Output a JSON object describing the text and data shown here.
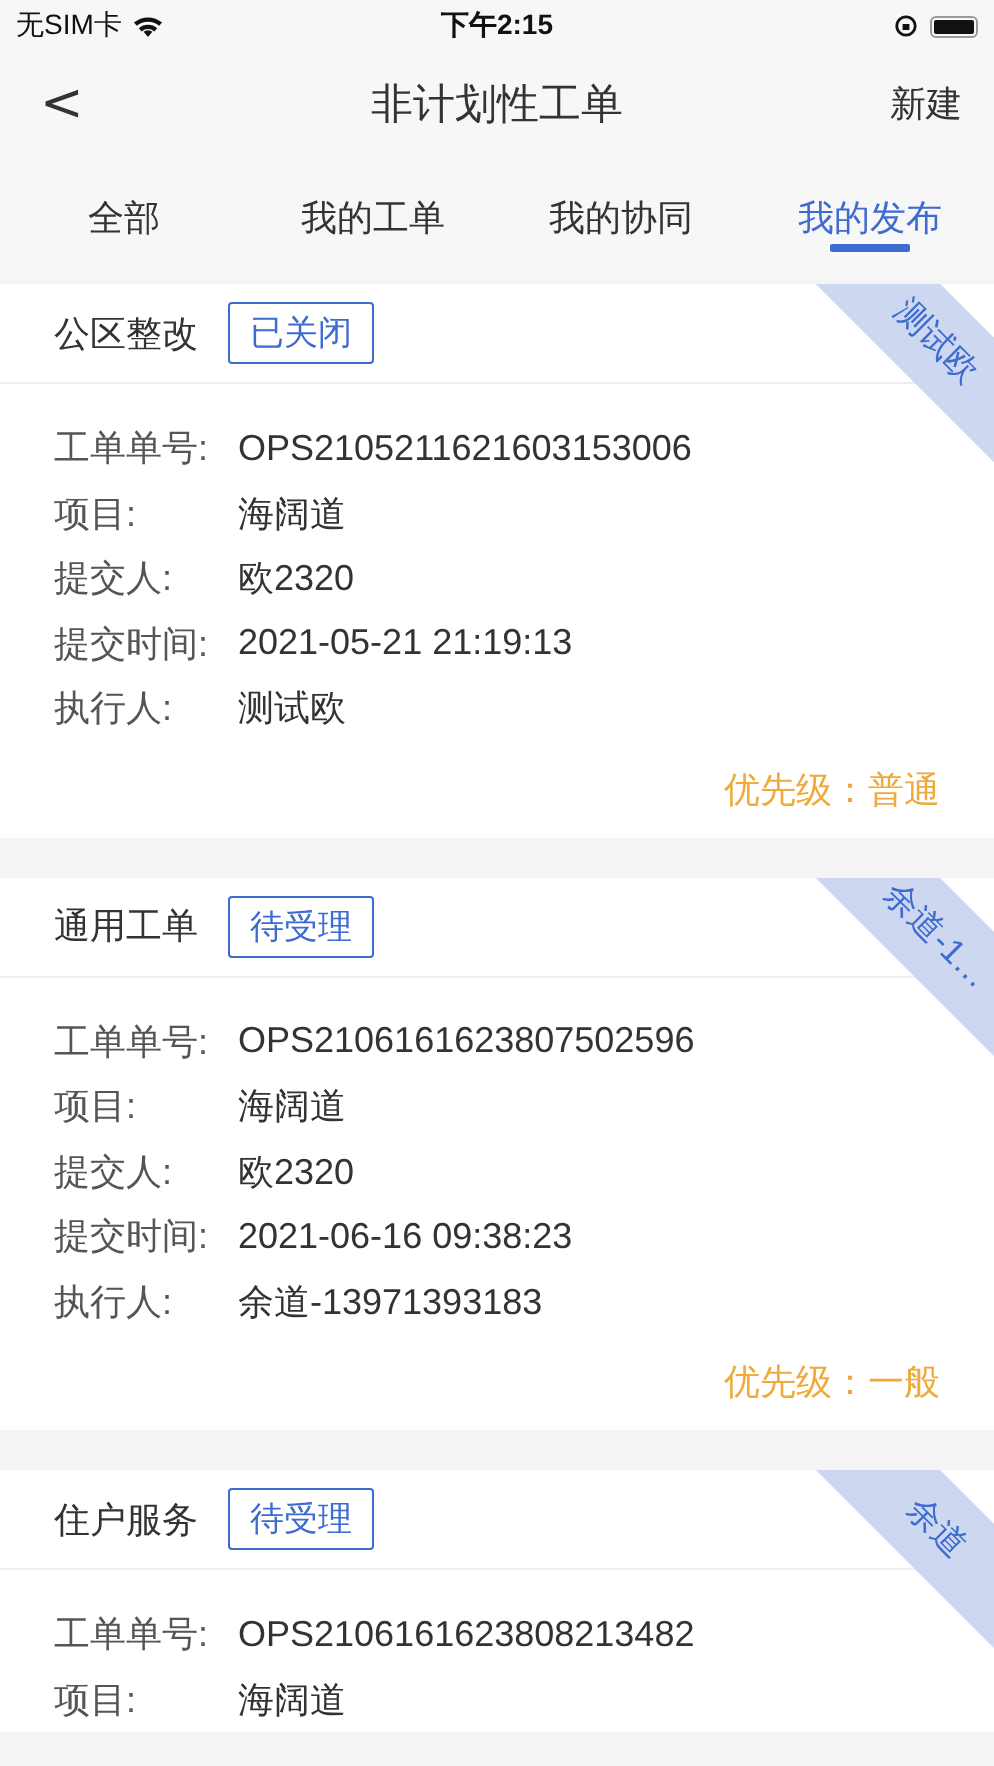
{
  "status_bar": {
    "carrier": "无SIM卡",
    "time": "下午2:15"
  },
  "nav": {
    "back": "<",
    "title": "非计划性工单",
    "action": "新建"
  },
  "tabs": [
    {
      "label": "全部",
      "selected": false
    },
    {
      "label": "我的工单",
      "selected": false
    },
    {
      "label": "我的协同",
      "selected": false
    },
    {
      "label": "我的发布",
      "selected": true
    }
  ],
  "orders": [
    {
      "type": "公区整改",
      "status": "已关闭",
      "ribbon": "测试欧",
      "fields": [
        {
          "label": "工单单号:",
          "value": "OPS2105211621603153006"
        },
        {
          "label": "项目:",
          "value": "海阔道"
        },
        {
          "label": "提交人:",
          "value": "欧2320"
        },
        {
          "label": "提交时间:",
          "value": "2021-05-21 21:19:13"
        },
        {
          "label": "执行人:",
          "value": "测试欧"
        }
      ],
      "priority": "优先级：普通"
    },
    {
      "type": "通用工单",
      "status": "待受理",
      "ribbon": "余道-1…",
      "fields": [
        {
          "label": "工单单号:",
          "value": "OPS2106161623807502596"
        },
        {
          "label": "项目:",
          "value": "海阔道"
        },
        {
          "label": "提交人:",
          "value": "欧2320"
        },
        {
          "label": "提交时间:",
          "value": "2021-06-16 09:38:23"
        },
        {
          "label": "执行人:",
          "value": "余道-13971393183"
        }
      ],
      "priority": "优先级：一般"
    },
    {
      "type": "住户服务",
      "status": "待受理",
      "ribbon": "余道",
      "fields": [
        {
          "label": "工单单号:",
          "value": "OPS2106161623808213482"
        },
        {
          "label": "项目:",
          "value": "海阔道"
        }
      ]
    }
  ]
}
